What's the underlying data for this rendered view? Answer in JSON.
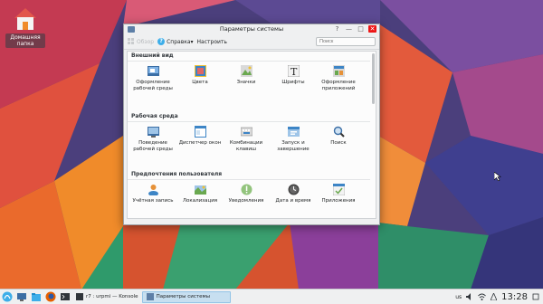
{
  "desktop": {
    "home_label": "Домашняя\nпапка"
  },
  "window": {
    "title": "Параметры системы",
    "controls": {
      "help": "?",
      "minimize": "—",
      "maximize": "□",
      "close": "✕"
    }
  },
  "toolbar": {
    "overview": "Обзор",
    "help": "Справка▾",
    "configure": "Настроить",
    "search_placeholder": "Поиск"
  },
  "sections": [
    {
      "title": "Внешний вид",
      "items": [
        {
          "label": "Оформление\nрабочей среды",
          "icon": "workspace-theme-icon"
        },
        {
          "label": "Цвета",
          "icon": "colors-icon"
        },
        {
          "label": "Значки",
          "icon": "icons-icon"
        },
        {
          "label": "Шрифты",
          "icon": "fonts-icon"
        },
        {
          "label": "Оформление\nприложений",
          "icon": "application-style-icon"
        }
      ]
    },
    {
      "title": "Рабочая среда",
      "items": [
        {
          "label": "Поведение\nрабочей среды",
          "icon": "desktop-behavior-icon"
        },
        {
          "label": "Диспетчер окон",
          "icon": "window-manager-icon"
        },
        {
          "label": "Комбинации\nклавиш",
          "icon": "shortcuts-icon"
        },
        {
          "label": "Запуск и\nзавершение",
          "icon": "startup-shutdown-icon"
        },
        {
          "label": "Поиск",
          "icon": "search-icon"
        }
      ]
    },
    {
      "title": "Предпочтения пользователя",
      "items": [
        {
          "label": "Учётная запись",
          "icon": "account-icon"
        },
        {
          "label": "Локализация",
          "icon": "locale-icon"
        },
        {
          "label": "Уведомления",
          "icon": "notifications-icon"
        },
        {
          "label": "Дата и время",
          "icon": "clock-icon"
        },
        {
          "label": "Приложения",
          "icon": "applications-icon"
        }
      ]
    }
  ],
  "taskbar": {
    "tasks": [
      {
        "label": "r7 : urpmi — Konsole",
        "active": false
      },
      {
        "label": "Параметры системы",
        "active": true
      }
    ],
    "tray": {
      "keyboard": "us",
      "clock": "13:28"
    }
  },
  "colors": {
    "accent": "#3daee9",
    "close": "#ed1515",
    "panel": "#eff0f1"
  }
}
